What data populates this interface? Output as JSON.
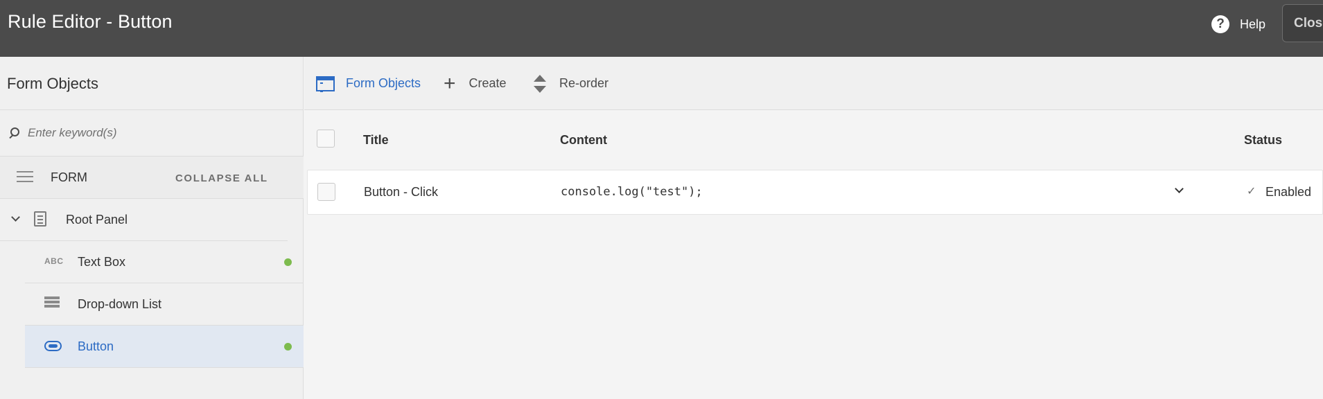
{
  "header": {
    "title": "Rule Editor - Button",
    "help_label": "Help",
    "close_label": "Close"
  },
  "sidebar": {
    "title": "Form Objects",
    "search_placeholder": "Enter keyword(s)",
    "form_label": "FORM",
    "collapse_all_label": "COLLAPSE ALL",
    "tree": [
      {
        "label": "Root Panel",
        "icon": "panel-icon",
        "expanded": true,
        "has_rule": false
      },
      {
        "label": "Text Box",
        "icon": "text-box-icon",
        "has_rule": true
      },
      {
        "label": "Drop-down List",
        "icon": "dropdown-list-icon",
        "has_rule": false
      },
      {
        "label": "Button",
        "icon": "button-icon",
        "has_rule": true,
        "selected": true
      }
    ],
    "abc_text": "ABC"
  },
  "toolbar": {
    "form_objects_label": "Form Objects",
    "create_label": "Create",
    "reorder_label": "Re-order"
  },
  "table": {
    "columns": [
      "Title",
      "Content",
      "Status"
    ],
    "rows": [
      {
        "title": "Button - Click",
        "content": "console.log(\"test\");",
        "status": "Enabled"
      }
    ]
  },
  "colors": {
    "header_bg": "#4b4b4b",
    "accent": "#2c6bc4",
    "rule_dot": "#7dbb4e",
    "selected_bg": "#e1e8f2"
  }
}
